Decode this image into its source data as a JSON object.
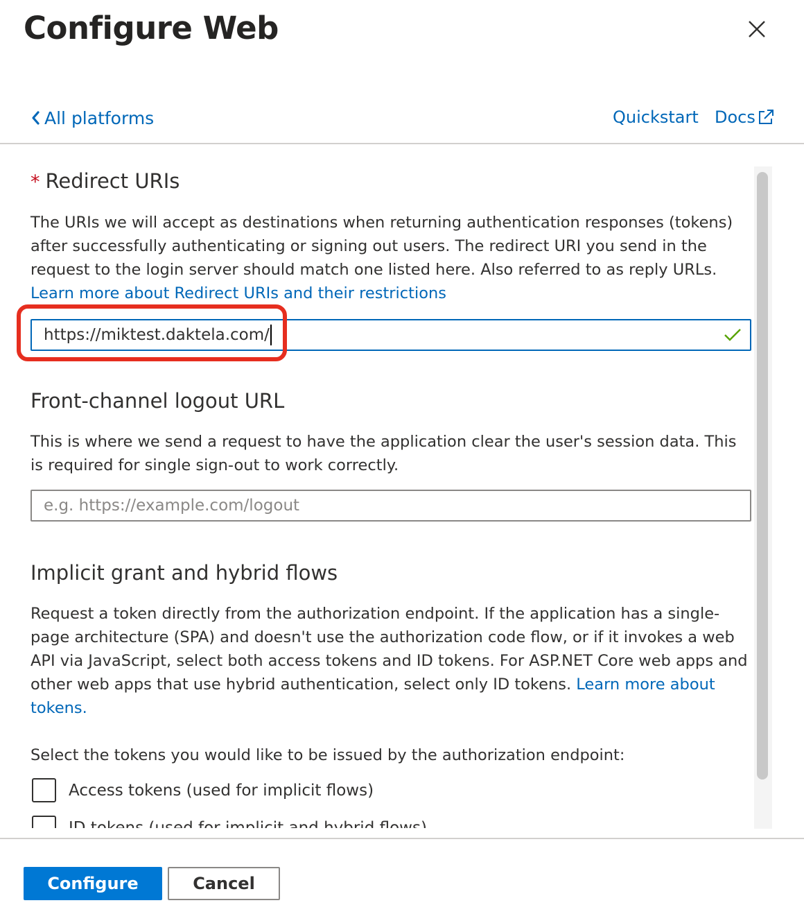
{
  "header": {
    "title": "Configure Web",
    "close_icon": "close-icon"
  },
  "nav": {
    "back_label": "All platforms",
    "quickstart_label": "Quickstart",
    "docs_label": "Docs"
  },
  "redirect": {
    "heading": "Redirect URIs",
    "required_mark": "*",
    "description": "The URIs we will accept as destinations when returning authentication responses (tokens) after successfully authenticating or signing out users. The redirect URI you send in the request to the login server should match one listed here. Also referred to as reply URLs.",
    "link": "Learn more about Redirect URIs and their restrictions",
    "value": "https://miktest.daktela.com/",
    "valid": true
  },
  "logout": {
    "heading": "Front-channel logout URL",
    "description": "This is where we send a request to have the application clear the user's session data. This is required for single sign-out to work correctly.",
    "placeholder": "e.g. https://example.com/logout"
  },
  "implicit": {
    "heading": "Implicit grant and hybrid flows",
    "description": "Request a token directly from the authorization endpoint. If the application has a single-page architecture (SPA) and doesn't use the authorization code flow, or if it invokes a web API via JavaScript, select both access tokens and ID tokens. For ASP.NET Core web apps and other web apps that use hybrid authentication, select only ID tokens.",
    "link": "Learn more about tokens.",
    "select_prompt": "Select the tokens you would like to be issued by the authorization endpoint:",
    "options": [
      {
        "label": "Access tokens (used for implicit flows)",
        "checked": false
      },
      {
        "label": "ID tokens (used for implicit and hybrid flows)",
        "checked": false
      }
    ]
  },
  "footer": {
    "configure_label": "Configure",
    "cancel_label": "Cancel"
  },
  "colors": {
    "accent": "#0078d4",
    "link": "#0067b8",
    "highlight": "#e62e1f",
    "valid": "#57a300"
  }
}
